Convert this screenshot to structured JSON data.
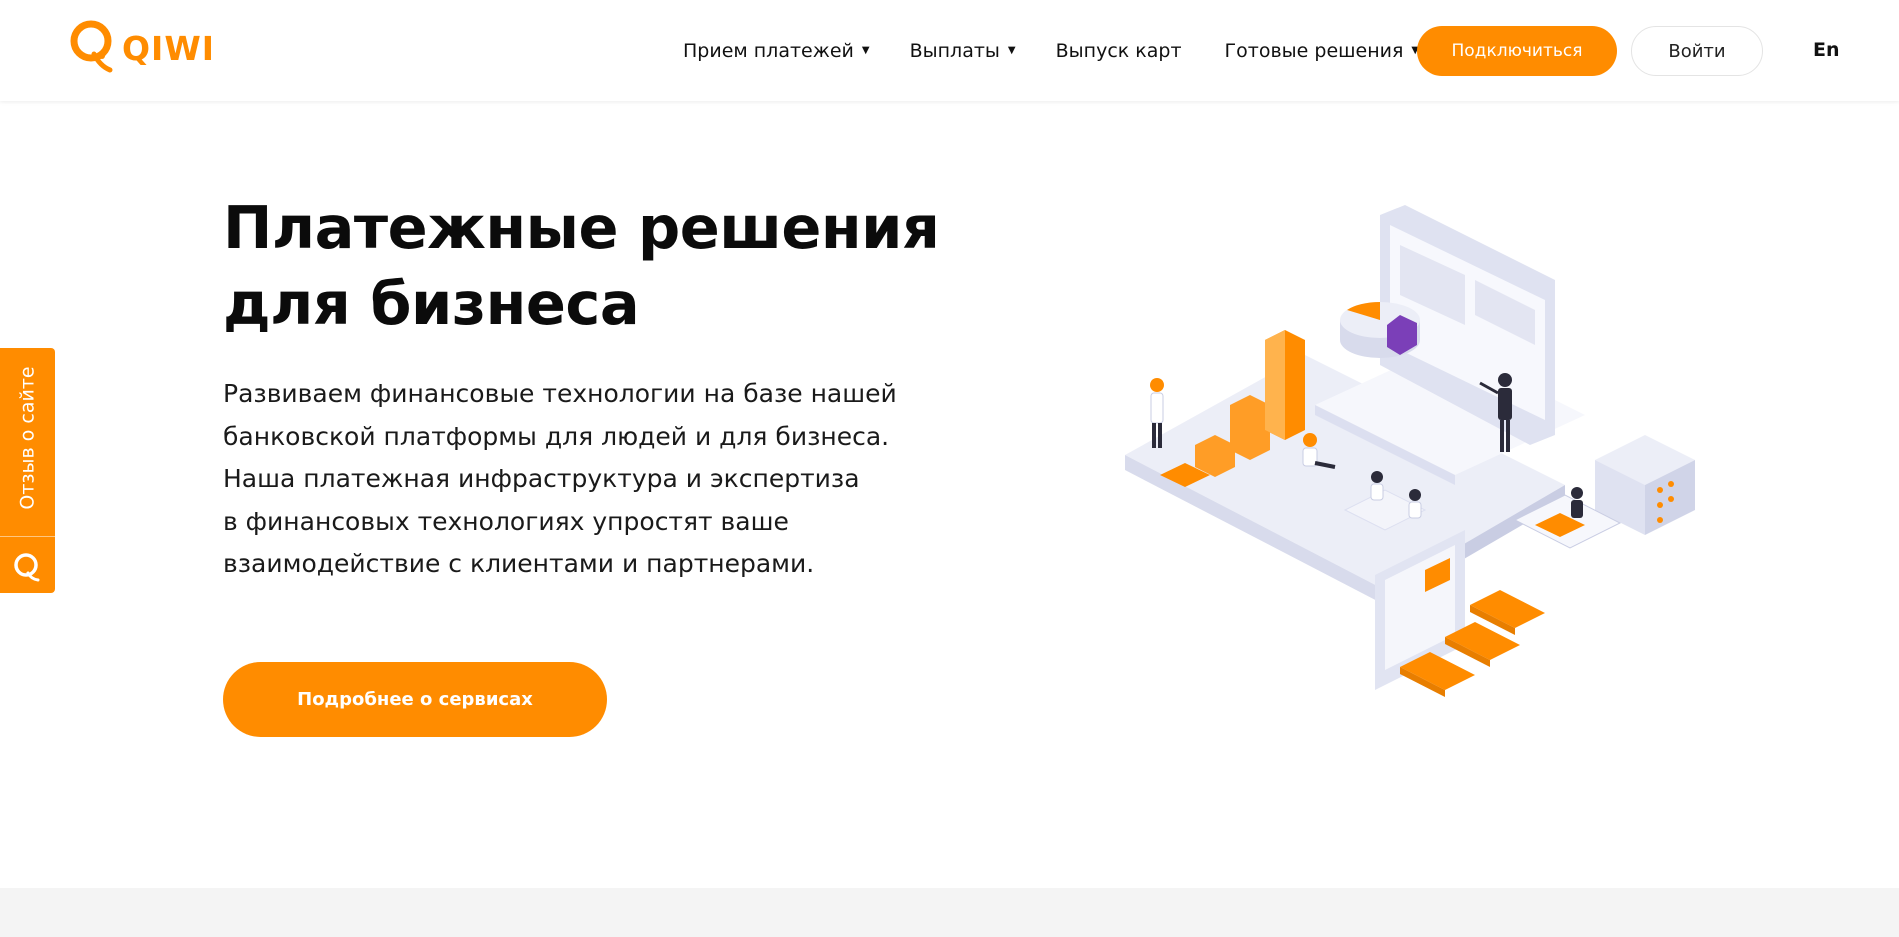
{
  "header": {
    "logo_text": "QIWI",
    "nav": [
      {
        "label": "Прием платежей",
        "has_dropdown": true
      },
      {
        "label": "Выплаты",
        "has_dropdown": true
      },
      {
        "label": "Выпуск карт",
        "has_dropdown": false
      },
      {
        "label": "Готовые решения",
        "has_dropdown": true
      }
    ],
    "connect_label": "Подключиться",
    "login_label": "Войти",
    "lang_label": "En"
  },
  "feedback": {
    "label": "Отзыв о сайте"
  },
  "hero": {
    "title_line1": "Платежные решения",
    "title_line2": "для бизнеса",
    "description_lines": [
      "Развиваем финансовые технологии на базе нашей",
      "банковской платформы для людей и для бизнеса.",
      "Наша платежная инфраструктура и экспертиза",
      "в финансовых технологиях упростят ваше",
      "взаимодействие с клиентами и партнерами."
    ],
    "more_button_label": "Подробнее о сервисах"
  },
  "colors": {
    "accent": "#ff8c00",
    "text": "#111111",
    "illustration_base": "#e6e7f3",
    "illustration_purple": "#7b3fb8"
  },
  "icons": {
    "logo": "qiwi-logo-icon",
    "caret": "caret-down-icon",
    "feedback": "qiwi-q-icon"
  }
}
